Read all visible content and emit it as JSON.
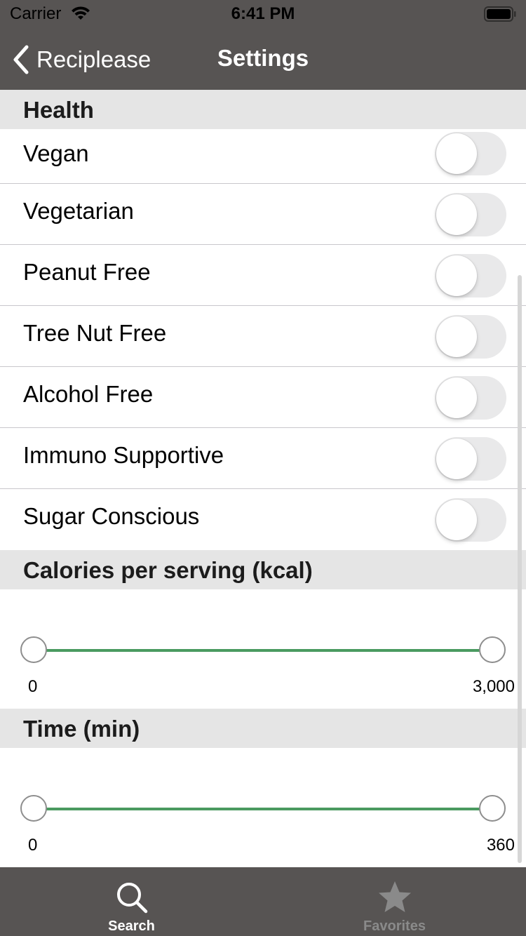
{
  "status_bar": {
    "carrier": "Carrier",
    "time": "6:41 PM",
    "wifi_icon": "wifi-icon",
    "battery_icon": "battery-icon"
  },
  "nav": {
    "back_label": "Reciplease",
    "back_icon": "chevron-left-icon",
    "title": "Settings"
  },
  "health": {
    "header": "Health",
    "items": [
      {
        "label": "Vegan",
        "on": false
      },
      {
        "label": "Vegetarian",
        "on": false
      },
      {
        "label": "Peanut Free",
        "on": false
      },
      {
        "label": "Tree Nut Free",
        "on": false
      },
      {
        "label": "Alcohol Free",
        "on": false
      },
      {
        "label": "Immuno Supportive",
        "on": false
      },
      {
        "label": "Sugar Conscious",
        "on": false
      }
    ]
  },
  "calories": {
    "header": "Calories per serving (kcal)",
    "min_label": "0",
    "max_label": "3,000",
    "selected_min": 0,
    "selected_max": 3000
  },
  "time": {
    "header": "Time (min)",
    "min_label": "0",
    "max_label": "360",
    "selected_min": 0,
    "selected_max": 360
  },
  "tabbar": {
    "tabs": [
      {
        "label": "Search",
        "icon": "search-icon",
        "active": true
      },
      {
        "label": "Favorites",
        "icon": "star-icon",
        "active": false
      }
    ]
  },
  "colors": {
    "bar_background": "#575453",
    "section_background": "#e5e5e5",
    "slider_track": "#4a9a60",
    "switch_off": "#e9e9ea",
    "inactive_tab": "#8a8a8a"
  }
}
